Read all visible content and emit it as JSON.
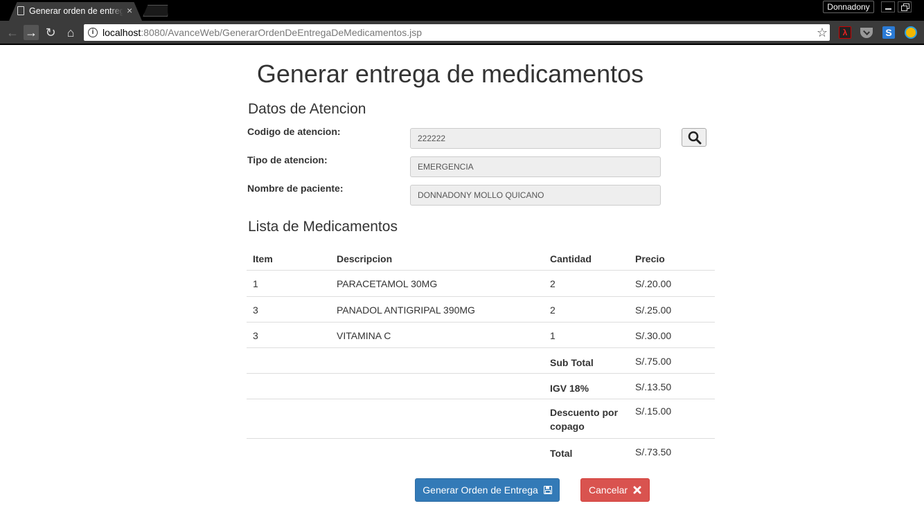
{
  "browser": {
    "tab_title": "Generar orden de entrega de medicamentos",
    "tab_close": "×",
    "profile_name": "Donnadony",
    "url_host": "localhost",
    "url_rest": ":8080/AvanceWeb/GenerarOrdenDeEntregaDeMedicamentos.jsp",
    "icons": [
      "back-icon",
      "forward-icon",
      "reload-icon",
      "home-icon",
      "info-icon",
      "star-icon",
      "pdf-extension-icon",
      "pocket-extension-icon",
      "s-extension-icon",
      "compass-extension-icon"
    ]
  },
  "page": {
    "title": "Generar entrega de medicamentos",
    "section_attention": "Datos de Atencion",
    "section_meds": "Lista de Medicamentos"
  },
  "form": {
    "codigo_label": "Codigo de atencion:",
    "codigo_value": "222222",
    "tipo_label": "Tipo de atencion:",
    "tipo_value": "EMERGENCIA",
    "nombre_label": "Nombre de paciente:",
    "nombre_value": "DONNADONY MOLLO QUICANO"
  },
  "table": {
    "headers": [
      "Item",
      "Descripcion",
      "Cantidad",
      "Precio"
    ],
    "rows": [
      {
        "item": "1",
        "descripcion": "PARACETAMOL 30MG",
        "cantidad": "2",
        "precio": "S/.20.00"
      },
      {
        "item": "3",
        "descripcion": "PANADOL ANTIGRIPAL 390MG",
        "cantidad": "2",
        "precio": "S/.25.00"
      },
      {
        "item": "3",
        "descripcion": "VITAMINA C",
        "cantidad": "1",
        "precio": "S/.30.00"
      }
    ],
    "summary": [
      {
        "label": "Sub Total",
        "value": "S/.75.00"
      },
      {
        "label": "IGV 18%",
        "value": "S/.13.50"
      },
      {
        "label": "Descuento por copago",
        "value": "S/.15.00"
      },
      {
        "label": "Total",
        "value": "S/.73.50"
      }
    ]
  },
  "actions": {
    "generate_label": "Generar Orden de Entrega",
    "cancel_label": "Cancelar"
  },
  "colors": {
    "primary": "#337ab7",
    "danger": "#d9534f",
    "input_bg": "#eeeeee"
  }
}
